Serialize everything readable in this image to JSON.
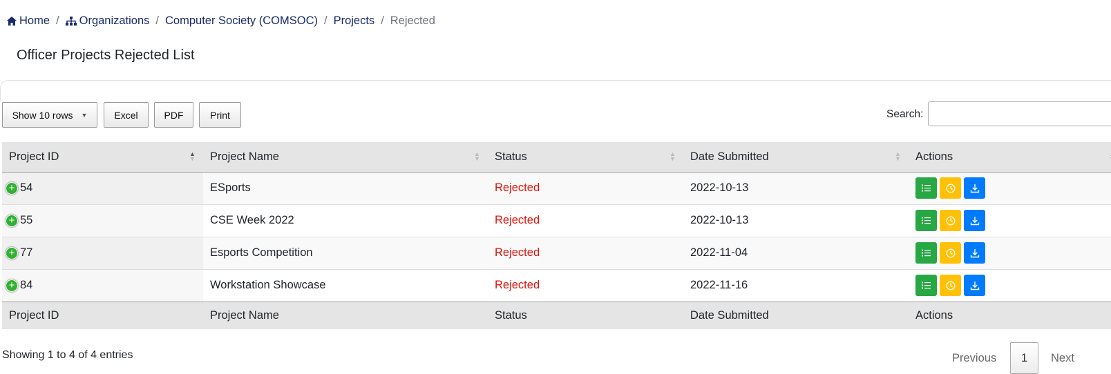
{
  "breadcrumb": {
    "home": "Home",
    "organizations": "Organizations",
    "organization": "Computer Society (COMSOC)",
    "projects": "Projects",
    "current": "Rejected",
    "separator": "/"
  },
  "page_title": "Officer Projects Rejected List",
  "toolbar": {
    "show_rows": "Show 10 rows",
    "excel": "Excel",
    "pdf": "PDF",
    "print": "Print",
    "search_label": "Search:",
    "search_value": ""
  },
  "table": {
    "columns": [
      "Project ID",
      "Project Name",
      "Status",
      "Date Submitted",
      "Actions"
    ],
    "rows": [
      {
        "id": "54",
        "name": "ESports",
        "status": "Rejected",
        "date": "2022-10-13"
      },
      {
        "id": "55",
        "name": "CSE Week 2022",
        "status": "Rejected",
        "date": "2022-10-13"
      },
      {
        "id": "77",
        "name": "Esports Competition",
        "status": "Rejected",
        "date": "2022-11-04"
      },
      {
        "id": "84",
        "name": "Workstation Showcase",
        "status": "Rejected",
        "date": "2022-11-16"
      }
    ],
    "action_icons": [
      "list-icon",
      "clock-icon",
      "download-icon"
    ]
  },
  "footer": {
    "info": "Showing 1 to 4 of 4 entries",
    "previous": "Previous",
    "page": "1",
    "next": "Next"
  },
  "colors": {
    "link": "#1a2a6c",
    "rejected": "#e3120b",
    "green": "#28a745",
    "yellow": "#ffc107",
    "blue": "#007bff"
  }
}
